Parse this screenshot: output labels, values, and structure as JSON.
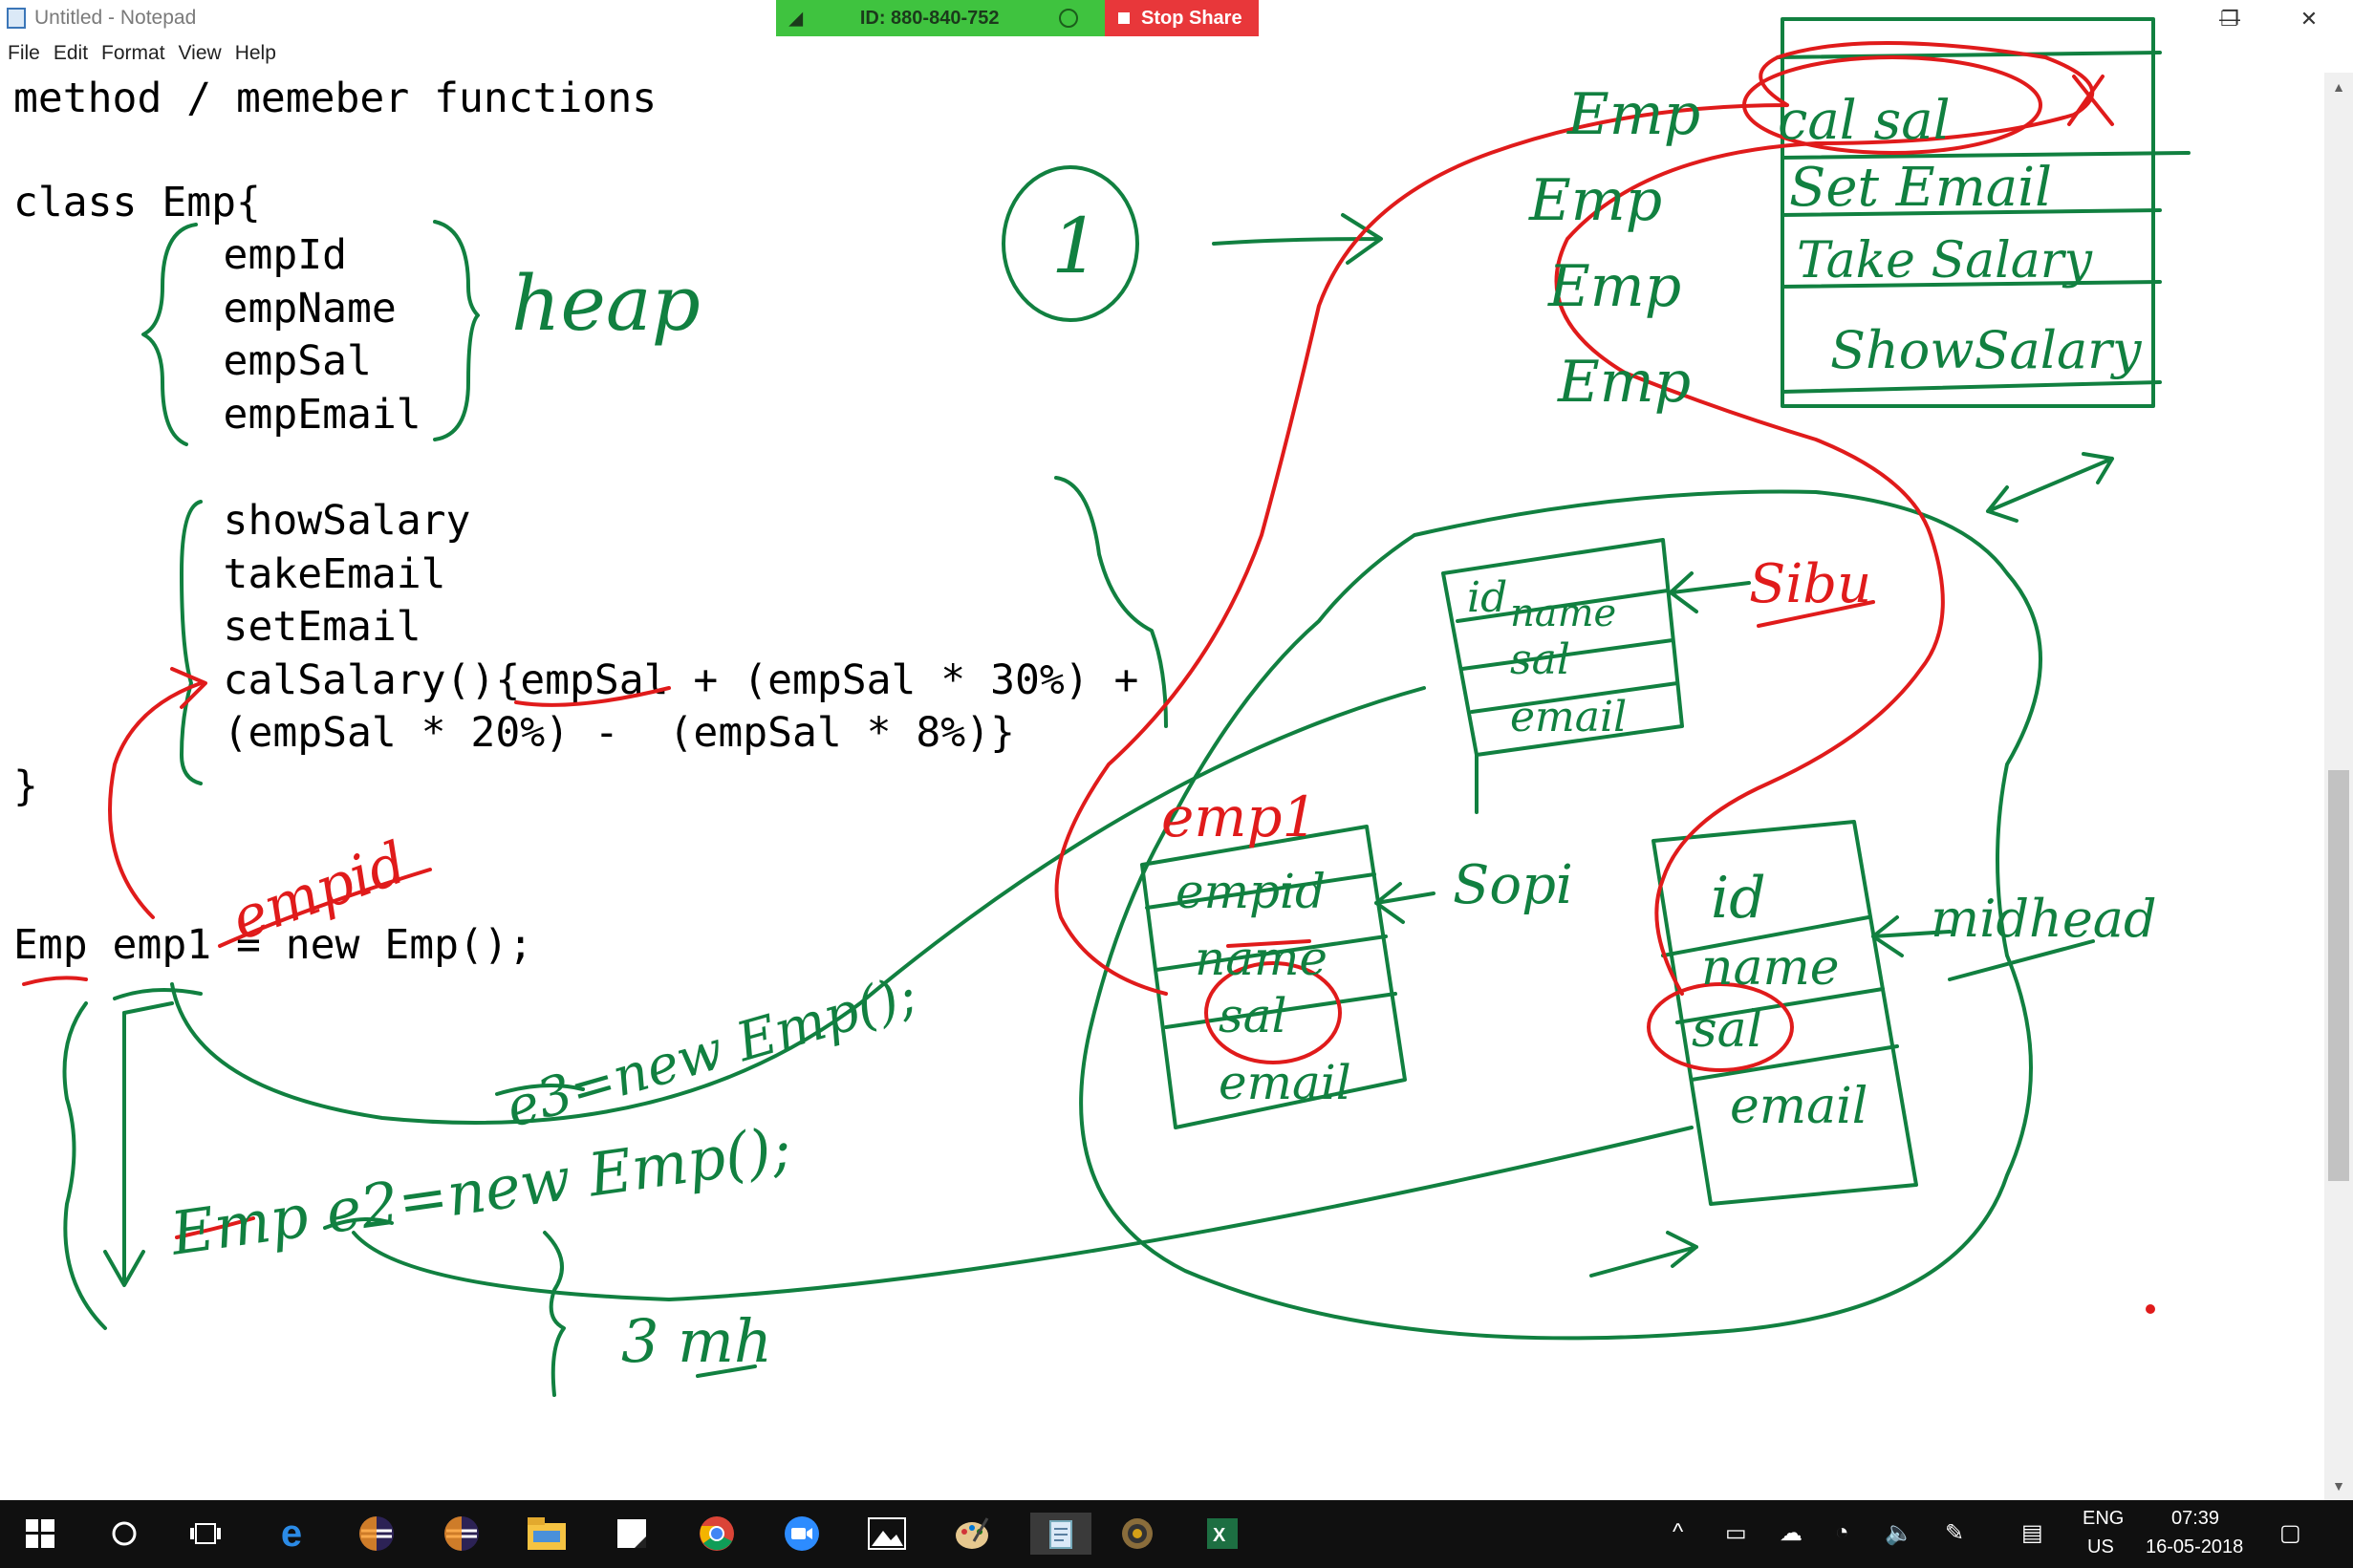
{
  "window": {
    "title": "Untitled - Notepad",
    "controls": {
      "minimize": "—",
      "restore": "❐",
      "close": "✕"
    }
  },
  "zoom": {
    "meeting_id": "ID: 880-840-752",
    "stop_share": "Stop Share"
  },
  "menu": [
    "File",
    "Edit",
    "Format",
    "View",
    "Help"
  ],
  "editor": {
    "lines": [
      "method / memeber functions",
      "class Emp{",
      "    empId",
      "    empName",
      "    empSal",
      "    empEmail",
      "    showSalary",
      "    takeEmail",
      "    setEmail",
      "    calSalary(){empSal + (empSal * 30%) +",
      "    (empSal * 20%) -  (empSal * 8%)}",
      "}",
      "Emp emp1 = new Emp();"
    ]
  },
  "annotations": {
    "heap": "heap",
    "circled_number": "1",
    "method_table": [
      "cal sal",
      "Set Email",
      "Take Salary",
      "ShowSalary"
    ],
    "emp_labels": [
      "Emp",
      "Emp",
      "Emp",
      "Emp"
    ],
    "object1": {
      "fields": [
        "id",
        "name",
        "sal",
        "email"
      ],
      "owner": "Sibu"
    },
    "object2": {
      "tag": "emp1",
      "fields": [
        "empid",
        "name",
        "sal",
        "email"
      ],
      "owner": "Sopi"
    },
    "object3": {
      "fields": [
        "id",
        "name",
        "sal",
        "email"
      ],
      "owner": "midhead"
    },
    "label_empid": "empid",
    "statement_e3": "e3=new Emp();",
    "statement_e2": "Emp e2=new Emp();",
    "duration": "3 mh",
    "colors": {
      "ink_green": "#118040",
      "ink_red": "#e01b1b"
    }
  },
  "taskbar": {
    "icons": [
      "windows-start",
      "cortana",
      "task-view",
      "edge",
      "eclipse",
      "eclipse",
      "file-explorer",
      "sticky-notes",
      "chrome",
      "zoom",
      "photos",
      "paint",
      "notepad",
      "settings",
      "excel"
    ],
    "tray": {
      "language": "ENG",
      "region": "US",
      "time": "07:39",
      "date": "16-05-2018"
    }
  }
}
